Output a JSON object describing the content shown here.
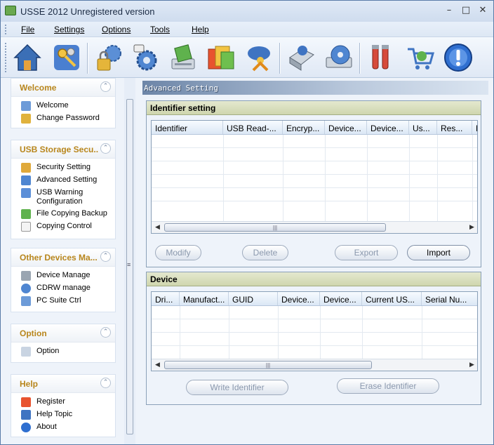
{
  "window": {
    "title": "USSE 2012 Unregistered version"
  },
  "menu": [
    "File",
    "Settings",
    "Options",
    "Tools",
    "Help"
  ],
  "toolbar": [
    "home-icon",
    "keys-icon",
    "lock-gear-icon",
    "usb-gear-icon",
    "printer-disk-icon",
    "files-icon",
    "network-user-icon",
    "device-manager-icon",
    "cd-drive-icon",
    "tools-icon",
    "shopping-cart-icon",
    "info-icon"
  ],
  "sidebar": [
    {
      "title": "Welcome",
      "items": [
        "Welcome",
        "Change Password"
      ]
    },
    {
      "title": "USB Storage Secu...",
      "items": [
        "Security Setting",
        "Advanced Setting",
        "USB Warning Configuration",
        "File Copying Backup",
        "Copying Control"
      ]
    },
    {
      "title": "Other Devices Ma...",
      "items": [
        "Device Manage",
        "CDRW manage",
        "PC Suite Ctrl"
      ]
    },
    {
      "title": "Option",
      "items": [
        "Option"
      ]
    },
    {
      "title": "Help",
      "items": [
        "Register",
        "Help Topic",
        "About"
      ]
    }
  ],
  "content": {
    "section_title": "Advanced Setting",
    "identifier_group": {
      "title": "Identifier setting",
      "columns": [
        "Identifier",
        "USB Read-...",
        "Encryp...",
        "Device...",
        "Device...",
        "Us...",
        "Res...",
        "F"
      ],
      "buttons": {
        "modify": "Modify",
        "delete": "Delete",
        "export": "Export",
        "import": "Import"
      }
    },
    "device_group": {
      "title": "Device",
      "columns": [
        "Dri...",
        "Manufact...",
        "GUID",
        "Device...",
        "Device...",
        "Current US...",
        "Serial Nu..."
      ],
      "buttons": {
        "write": "Write Identifier",
        "erase": "Erase Identifier"
      }
    }
  },
  "colors": {
    "panel_title": "#b8861c",
    "group_header": "#cfd6ae"
  }
}
